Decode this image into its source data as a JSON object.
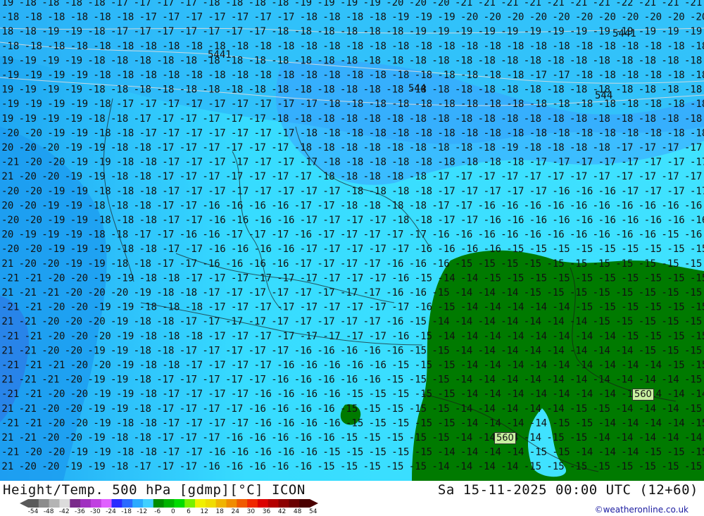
{
  "title": "Height/Temp. 500 hPa [gdmp][°C] ICON",
  "datetime": "Sa 15-11-2025 00:00 UTC (12+60)",
  "credit": "©weatheronline.co.uk",
  "legend": {
    "ticks": [
      "-54",
      "-48",
      "-42",
      "-36",
      "-30",
      "-24",
      "-18",
      "-12",
      "-6",
      "0",
      "6",
      "12",
      "18",
      "24",
      "30",
      "36",
      "42",
      "48",
      "54"
    ],
    "colors": [
      "#5a5a5a",
      "#8c8c8c",
      "#b4b4b4",
      "#dcdcdc",
      "#7a2a8a",
      "#a030c0",
      "#c040e0",
      "#e060ff",
      "#2a2aff",
      "#2a6aff",
      "#2aaaff",
      "#40d0ff",
      "#008c00",
      "#00b400",
      "#00dc00",
      "#78f000",
      "#f0f000",
      "#f0dc00",
      "#f0b400",
      "#f08c00",
      "#f05a00",
      "#f02800",
      "#dc0000",
      "#b40000",
      "#8c0000",
      "#6a0000",
      "#4a0000"
    ]
  },
  "contours": {
    "geopotential_labels": [
      "5441",
      "544",
      "544",
      "5441",
      "560",
      "560"
    ]
  },
  "grid_rows": [
    "19 18 18 18 18 17 17 17 17 18 18 18 18 19 19 19 19 20 20 20 21 21 21 21 21 21 21 22 21 21 21 21 21",
    "18 18 18 18 18 18 17 17 17 17 17 17 17 18 18 18 18 19 19 19 20 20 20 20 20 20 20 20 20 20 20 21",
    "18 18 19 19 18 17 17 17 17 17 17 17 18 18 18 18 18 18 19 19 19 19 19 19 19 19 19 19 19 19 19",
    "18 18 18 18 18 18 18 18 18 18 18 18 18 18 18 18 18 18 18 18 18 18 18 18 18 18 18 18 18 18 18",
    "19 19 19 19 18 18 18 18 18 18 18 18 18 18 18 18 18 18 18 18 18 18 18 18 18 18 18 18 18 18 18",
    "19 19 19 19 18 18 18 18 18 18 18 18 18 18 18 18 18 18 18 18 18 18 18 17 17 18 18 18 18 18 18",
    "19 19 19 19 18 18 18 18 18 18 18 18 18 18 18 18 18 18 18 18 18 18 18 18 18 18 18 18 18 18 18",
    "19 19 19 19 18 17 17 17 17 17 17 17 17 17 18 18 18 18 18 18 18 18 18 18 18 18 18 18 18 18 18",
    "19 19 19 19 18 18 17 17 17 17 17 17 18 18 18 18 18 18 18 18 18 18 18 18 18 18 18 18 18 18 18",
    "20 20 19 19 18 18 17 17 17 17 17 17 17 18 18 18 18 18 18 18 18 18 18 18 18 18 18 18 18 18 18",
    "20 20 20 19 19 18 18 17 17 17 17 17 17 18 18 18 18 18 18 18 18 18 19 18 18 18 18 17 17 17 17",
    "21 20 20 19 19 18 18 17 17 17 17 17 17 17 18 18 18 18 18 18 18 18 18 17 17 17 17 17 17 17 17",
    "21 20 20 19 19 18 18 17 17 17 17 17 17 17 18 18 18 18 18 17 17 17 17 17 17 17 17 17 17 17 17",
    "20 20 19 19 18 18 18 17 17 17 17 17 17 17 17 18 18 18 18 17 17 17 17 17 16 16 16 17 17 17 17",
    "20 20 19 19 18 18 18 17 17 16 16 16 16 17 17 18 18 18 18 17 17 16 16 16 16 16 16 16 16 16 16",
    "20 20 19 19 18 18 18 17 17 16 16 16 16 17 17 17 17 18 18 17 17 16 16 16 16 16 16 16 16 16 16",
    "20 19 19 19 18 18 17 17 16 16 17 17 17 16 17 17 17 17 17 16 16 16 16 16 16 16 16 16 16 15 16",
    "20 20 19 19 19 18 18 17 17 16 16 16 16 17 17 17 17 17 16 16 16 16 15 15 15 15 15 15 15 15 15",
    "21 20 20 19 19 18 18 17 17 16 16 16 16 17 17 17 17 16 16 16 15 15 15 15 15 15 15 15 15 15 15",
    "21 21 20 20 19 19 18 18 17 17 17 17 17 17 17 17 17 16 15 14 14 15 15 15 15 15 15 15 15 15 15",
    "21 21 21 20 20 20 19 18 18 17 17 17 17 17 17 17 17 16 16 15 14 14 14 15 15 15 15 15 15 15 15",
    "21 21 20 20 19 19 18 18 18 17 17 17 17 17 17 17 17 17 16 15 14 14 14 14 14 15 15 15 15 15 15",
    "21 21 20 20 20 19 18 18 17 17 17 17 17 17 17 17 17 16 15 14 14 14 14 14 14 14 15 15 15 15 15",
    "21 21 20 20 20 19 18 18 18 17 17 17 17 17 17 17 17 16 15 14 14 14 14 14 14 14 14 15 15 15 15",
    "21 21 20 20 19 19 18 18 17 17 17 17 17 16 16 16 16 16 15 15 14 14 14 14 14 14 14 14 15 15 15",
    "21 21 21 20 20 19 18 18 17 17 17 17 16 16 16 16 16 15 15 15 14 14 14 14 14 14 14 14 14 15 15",
    "21 21 21 20 19 19 18 17 17 17 17 17 16 16 16 16 16 15 15 15 14 14 14 14 14 14 14 14 14 14 15",
    "21 21 20 20 19 19 18 17 17 17 17 16 16 16 16 15 15 15 15 15 14 14 14 14 14 14 14 14 14 14 14",
    "21 21 20 20 19 19 18 17 17 17 17 16 16 16 16 15 15 15 15 15 14 14 14 14 14 15 15 14 14 14 15",
    "21 21 20 20 19 18 18 17 17 17 17 16 16 16 16 15 15 15 15 15 14 14 14 14 15 15 14 14 14 14 15",
    "21 21 20 20 19 18 18 17 17 17 16 16 16 16 16 15 15 15 15 15 14 14 14 14 15 15 14 14 14 14 14",
    "21 20 20 19 19 18 18 17 17 16 16 16 16 16 15 15 15 15 15 14 14 14 14 15 15 14 14 14 15 15 15",
    "21 20 20 19 19 18 17 17 17 16 16 16 16 16 15 15 15 15 15 14 14 14 14 15 15 15 15 15 15 15 15"
  ]
}
